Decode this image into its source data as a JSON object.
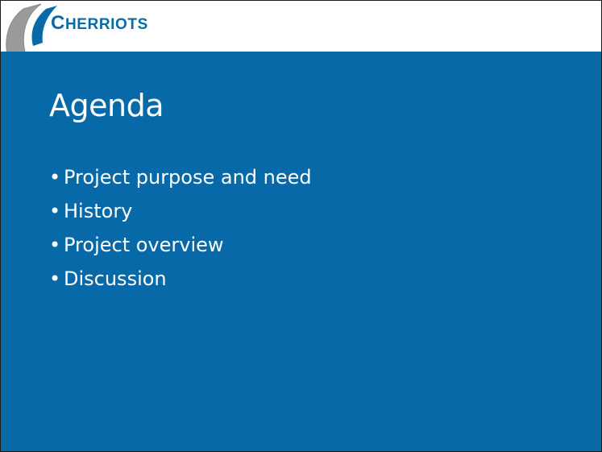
{
  "logo": {
    "text_first": "C",
    "text_rest": "HERRIOTS",
    "brand_color": "#0a6aa8",
    "arc_colors": [
      "#9a9a9a",
      "#0a6aa8"
    ]
  },
  "slide": {
    "background": "#0869a8",
    "title": "Agenda",
    "bullet_glyph": "•",
    "bullets": [
      "Project purpose and need",
      "History",
      "Project overview",
      "Discussion"
    ]
  }
}
